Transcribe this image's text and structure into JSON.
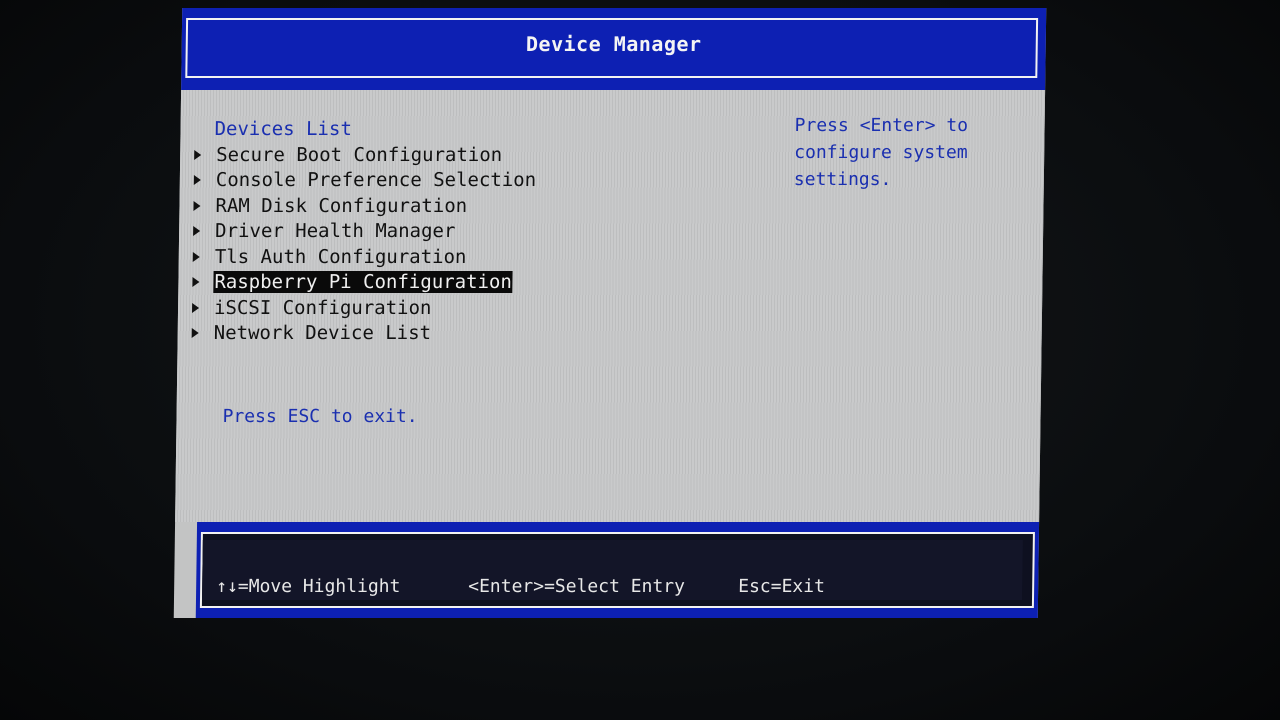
{
  "header": {
    "title": "Device Manager"
  },
  "devices": {
    "heading": "Devices List",
    "items": [
      {
        "label": "Secure Boot Configuration"
      },
      {
        "label": "Console Preference Selection"
      },
      {
        "label": "RAM Disk Configuration"
      },
      {
        "label": "Driver Health Manager"
      },
      {
        "label": "Tls Auth Configuration"
      },
      {
        "label": "Raspberry Pi Configuration",
        "selected": true
      },
      {
        "label": "iSCSI Configuration"
      },
      {
        "label": "Network Device List"
      }
    ],
    "esc_hint": "Press ESC to exit."
  },
  "help": {
    "text": "Press <Enter> to configure system settings."
  },
  "footer": {
    "move": "↑↓=Move Highlight",
    "select": "<Enter>=Select Entry",
    "exit": "Esc=Exit"
  },
  "colors": {
    "bios_blue": "#0d20b3",
    "panel_gray": "#c3c4c4",
    "help_text": "#1a2fb0",
    "highlight_bg": "#0a0a0a"
  },
  "icons": {
    "submenu_arrow": "triangle-right-icon"
  }
}
